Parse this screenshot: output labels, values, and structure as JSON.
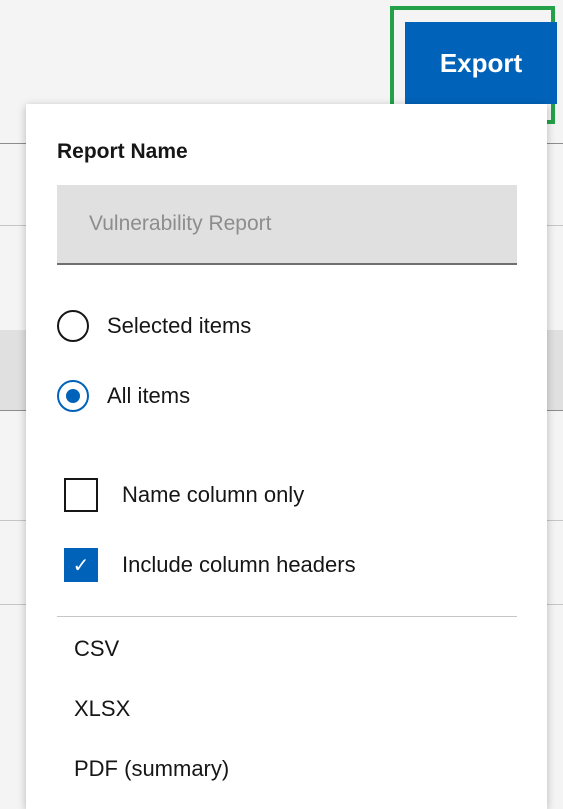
{
  "toolbar": {
    "export_label": "Export"
  },
  "export_menu": {
    "report_name_label": "Report Name",
    "report_name_placeholder": "Vulnerability Report",
    "scope_options": [
      {
        "label": "Selected items",
        "checked": false
      },
      {
        "label": "All items",
        "checked": true
      }
    ],
    "checkbox_options": [
      {
        "label": "Name column only",
        "checked": false
      },
      {
        "label": "Include column headers",
        "checked": true
      }
    ],
    "formats": [
      "CSV",
      "XLSX",
      "PDF (summary)"
    ]
  },
  "colors": {
    "primary": "#0062b8",
    "highlight": "#24a148"
  }
}
